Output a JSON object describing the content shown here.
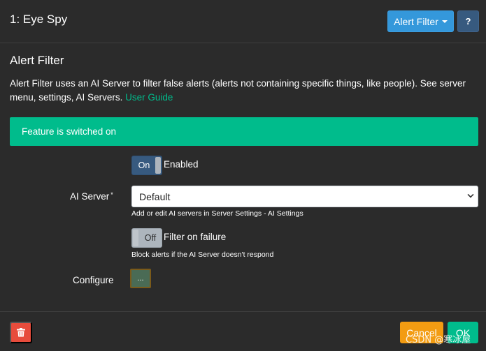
{
  "header": {
    "title": "1: Eye Spy",
    "alert_filter_label": "Alert Filter",
    "help_label": "?"
  },
  "section": {
    "title": "Alert Filter",
    "description": "Alert Filter uses an AI Server to filter false alerts (alerts not containing specific things, like people). See server menu, settings, AI Servers. ",
    "user_guide_link": "User Guide"
  },
  "banner": {
    "text": "Feature is switched on"
  },
  "enabled_toggle": {
    "state_label": "On",
    "label": "Enabled"
  },
  "ai_server": {
    "label": "AI Server",
    "required_mark": "*",
    "selected": "Default",
    "help": "Add or edit AI servers in Server Settings - AI Settings"
  },
  "filter_on_failure": {
    "state_label": "Off",
    "label": "Filter on failure",
    "help": "Block alerts if the AI Server doesn't respond"
  },
  "configure": {
    "label": "Configure",
    "button_label": "..."
  },
  "footer": {
    "cancel_label": "Cancel",
    "ok_label": "OK"
  },
  "watermark": "CSDN @寒冰屋",
  "icons": {
    "delete": "trash-icon",
    "dropdown": "chevron-down-icon"
  },
  "colors": {
    "primary": "#375a7f",
    "info": "#3498db",
    "success": "#00bc8c",
    "danger": "#e74c3c",
    "warning": "#f39c12",
    "background": "#2b2b2b"
  }
}
